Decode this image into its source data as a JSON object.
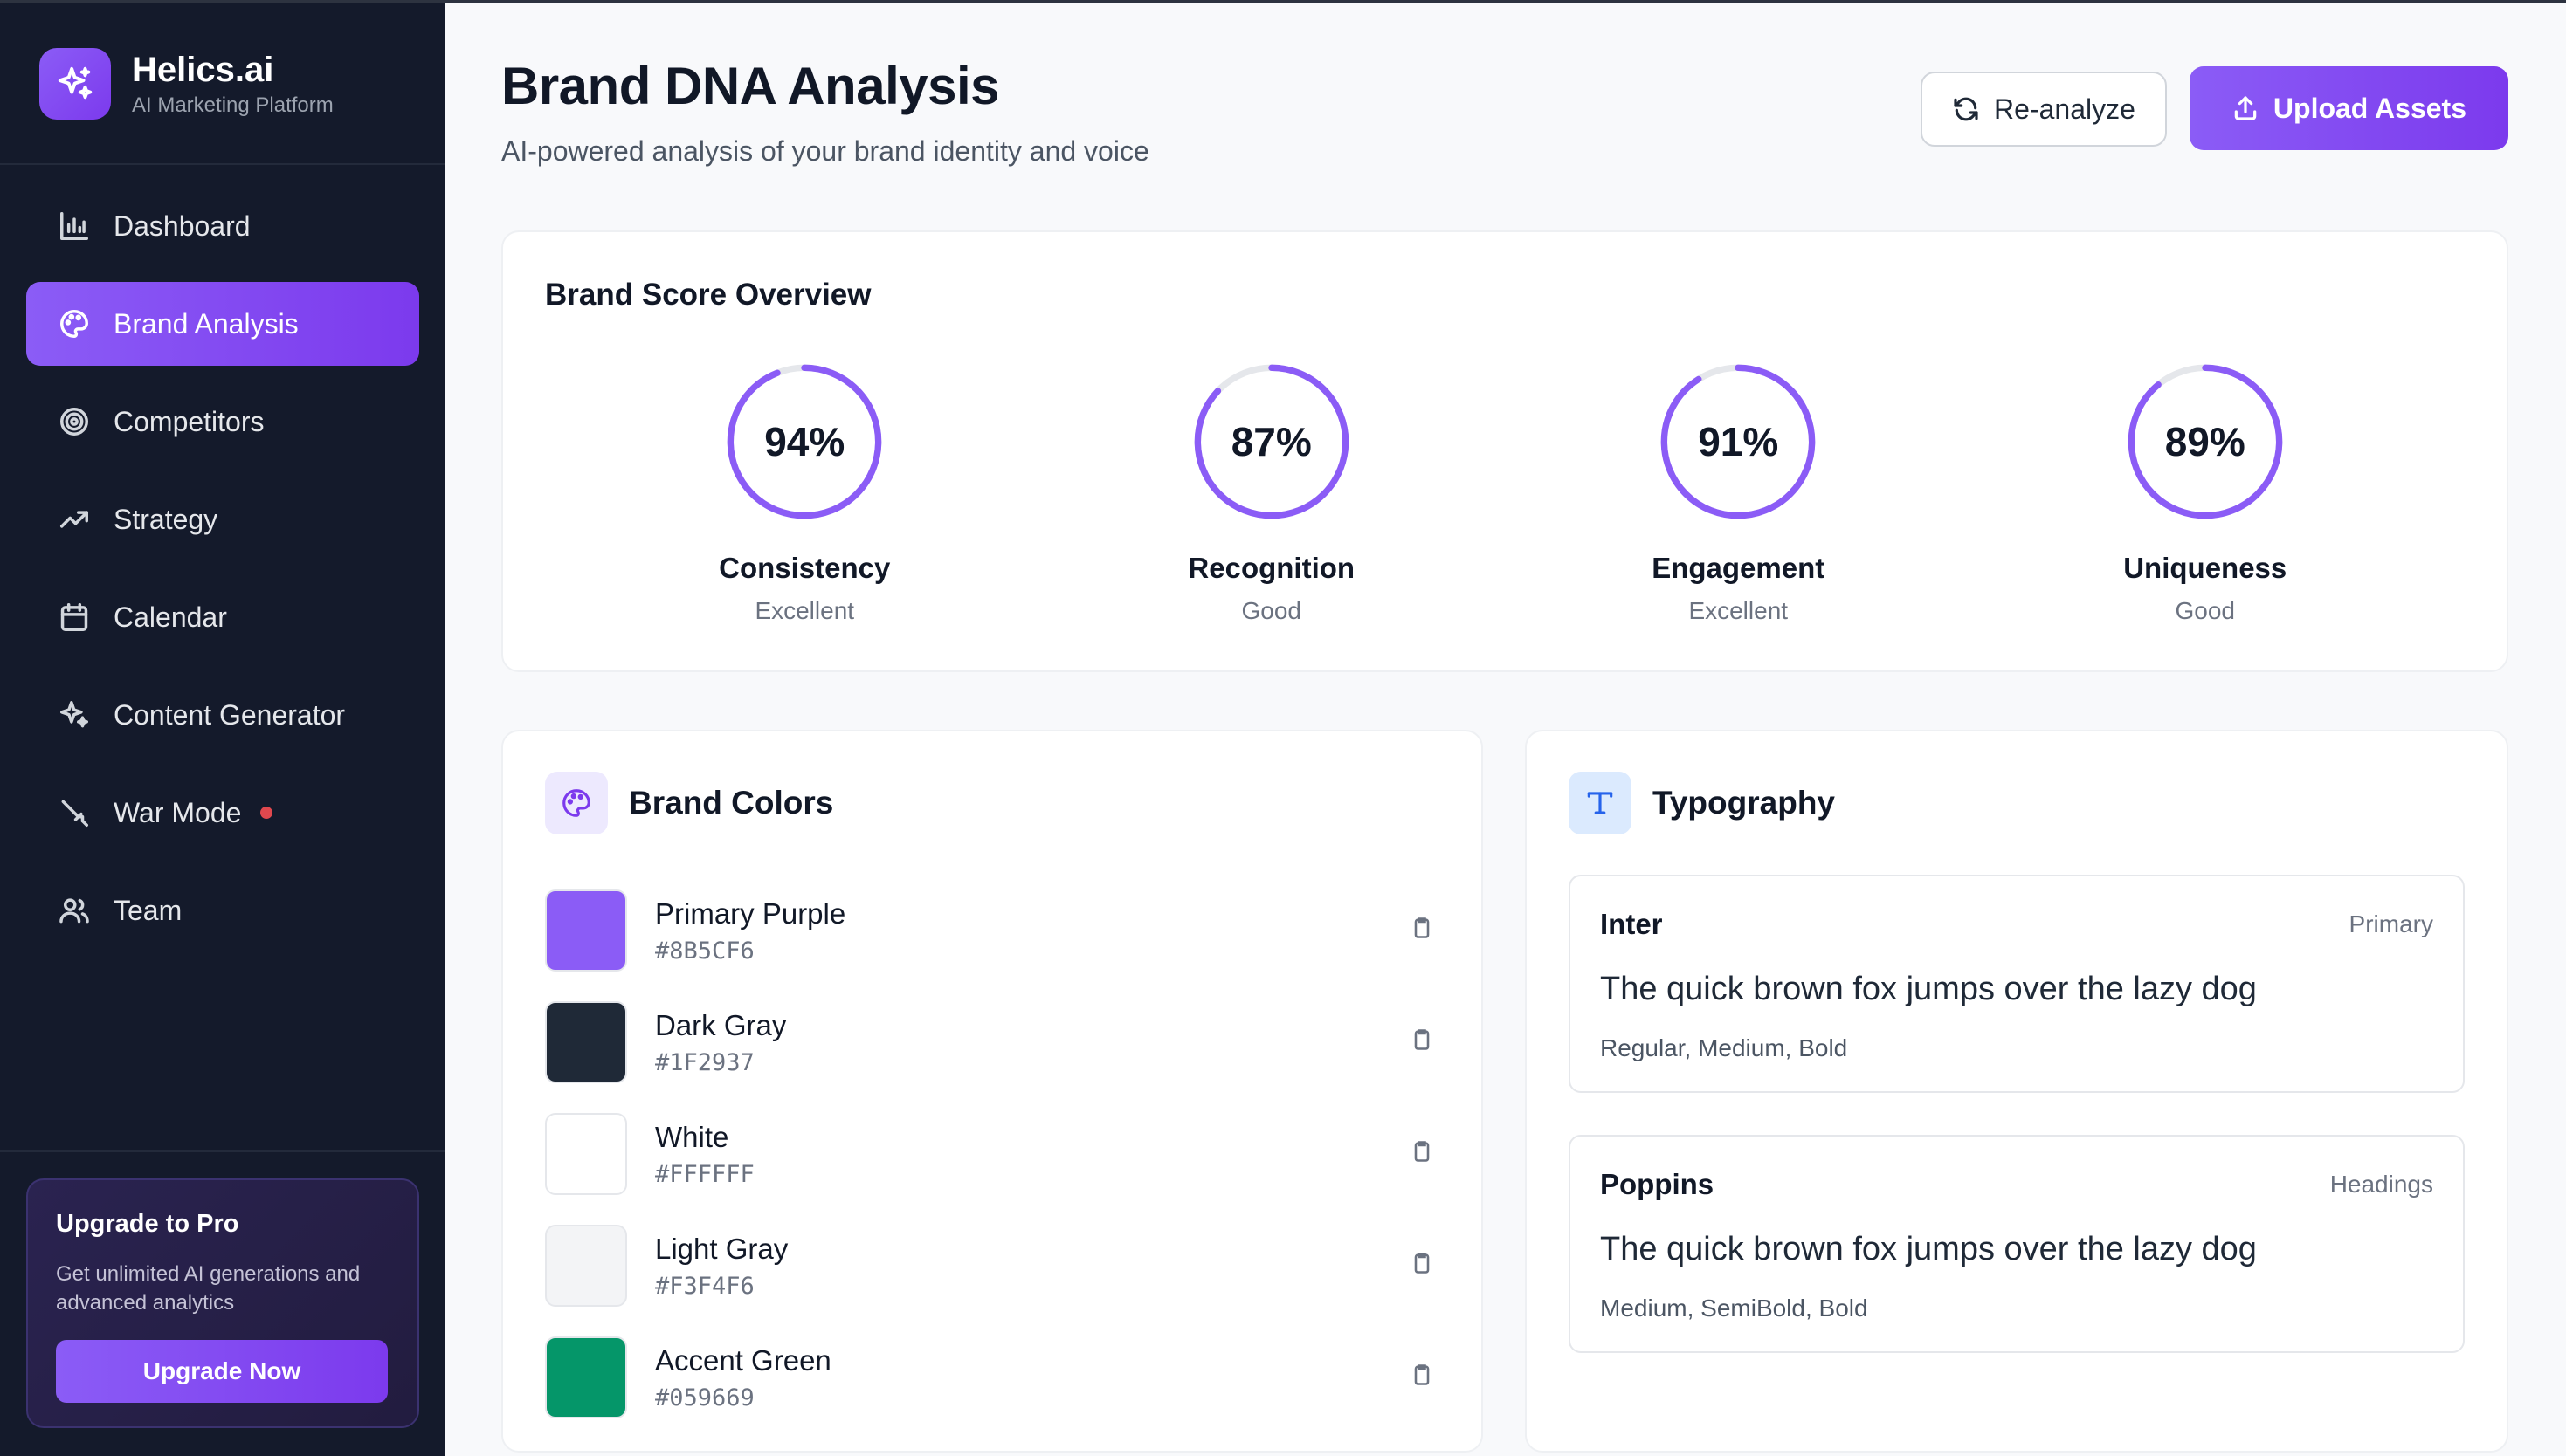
{
  "brand": {
    "name": "Helics.ai",
    "tagline": "AI Marketing Platform"
  },
  "sidebar": {
    "items": [
      {
        "label": "Dashboard",
        "icon": "bar-chart-icon",
        "active": false
      },
      {
        "label": "Brand Analysis",
        "icon": "palette-icon",
        "active": true
      },
      {
        "label": "Competitors",
        "icon": "target-icon",
        "active": false
      },
      {
        "label": "Strategy",
        "icon": "trending-up-icon",
        "active": false
      },
      {
        "label": "Calendar",
        "icon": "calendar-icon",
        "active": false
      },
      {
        "label": "Content Generator",
        "icon": "sparkles-icon",
        "active": false
      },
      {
        "label": "War Mode",
        "icon": "sword-icon",
        "active": false,
        "badge_color": "#e0484e"
      },
      {
        "label": "Team",
        "icon": "users-icon",
        "active": false
      }
    ],
    "upgrade": {
      "title": "Upgrade to Pro",
      "description": "Get unlimited AI generations and advanced analytics",
      "button": "Upgrade Now"
    }
  },
  "header": {
    "title": "Brand DNA Analysis",
    "subtitle": "AI-powered analysis of your brand identity and voice",
    "reanalyze_label": "Re-analyze",
    "upload_label": "Upload Assets"
  },
  "score_overview": {
    "title": "Brand Score Overview",
    "scores": [
      {
        "value": "94%",
        "percent": 94,
        "label": "Consistency",
        "rating": "Excellent"
      },
      {
        "value": "87%",
        "percent": 87,
        "label": "Recognition",
        "rating": "Good"
      },
      {
        "value": "91%",
        "percent": 91,
        "label": "Engagement",
        "rating": "Excellent"
      },
      {
        "value": "89%",
        "percent": 89,
        "label": "Uniqueness",
        "rating": "Good"
      }
    ]
  },
  "brand_colors": {
    "title": "Brand Colors",
    "colors": [
      {
        "name": "Primary Purple",
        "hex": "#8B5CF6"
      },
      {
        "name": "Dark Gray",
        "hex": "#1F2937"
      },
      {
        "name": "White",
        "hex": "#FFFFFF"
      },
      {
        "name": "Light Gray",
        "hex": "#F3F4F6"
      },
      {
        "name": "Accent Green",
        "hex": "#059669"
      }
    ]
  },
  "typography": {
    "title": "Typography",
    "fonts": [
      {
        "name": "Inter",
        "role": "Primary",
        "sample": "The quick brown fox jumps over the lazy dog",
        "weights": "Regular, Medium, Bold"
      },
      {
        "name": "Poppins",
        "role": "Headings",
        "sample": "The quick brown fox jumps over the lazy dog",
        "weights": "Medium, SemiBold, Bold"
      }
    ]
  },
  "colors": {
    "accent": "#8b5cf6",
    "sidebar_bg": "#141a2b",
    "ring_track": "#e5e7eb"
  }
}
